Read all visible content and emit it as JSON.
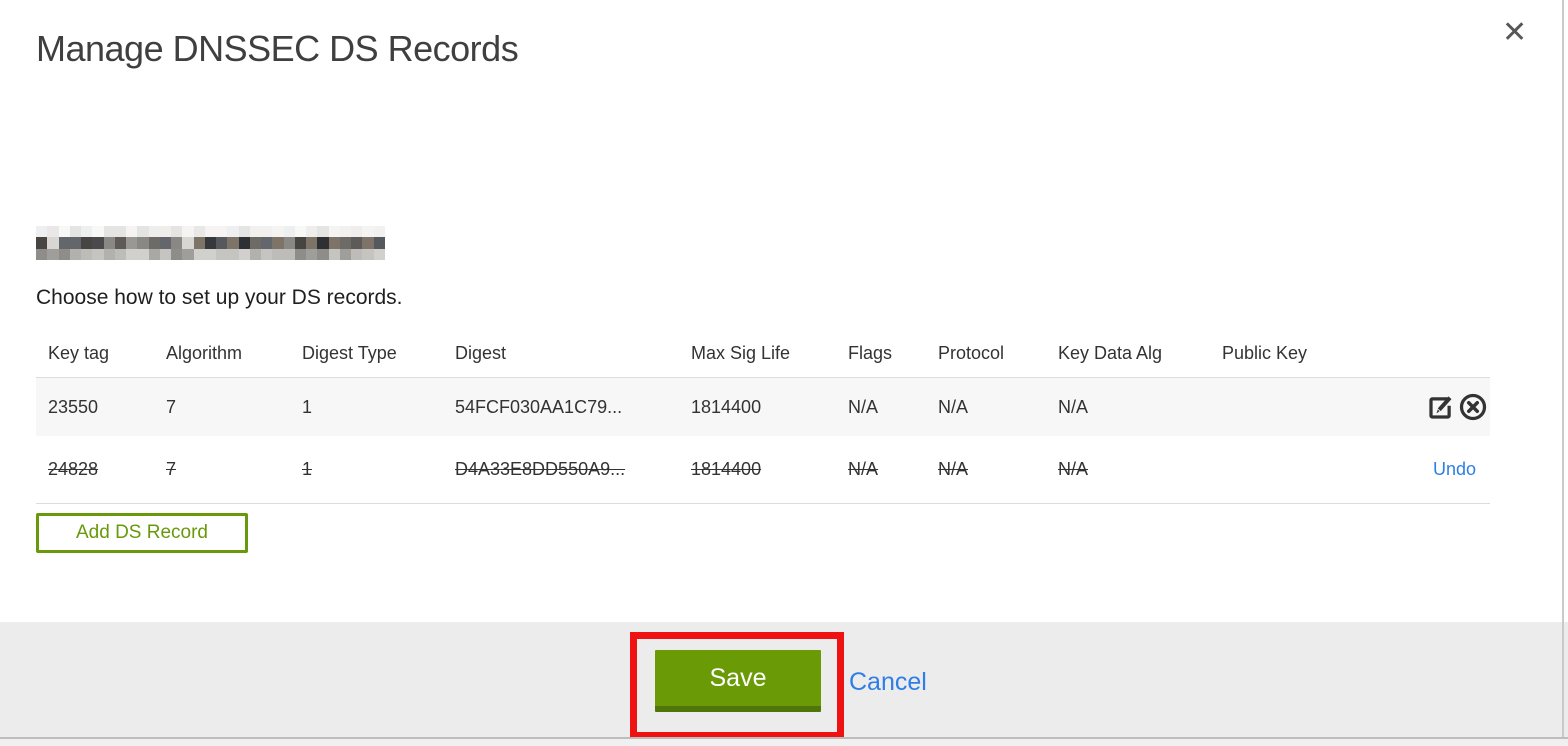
{
  "modal": {
    "title": "Manage DNSSEC DS Records",
    "close_icon": "close-icon",
    "close_glyph": "✕",
    "domain_redacted": true,
    "instruction": "Choose how to set up your DS records.",
    "table": {
      "columns": [
        "Key tag",
        "Algorithm",
        "Digest Type",
        "Digest",
        "Max Sig Life",
        "Flags",
        "Protocol",
        "Key Data Alg",
        "Public Key"
      ],
      "rows": [
        {
          "key_tag": "23550",
          "algorithm": "7",
          "digest_type": "1",
          "digest": "54FCF030AA1C79...",
          "max_sig_life": "1814400",
          "flags": "N/A",
          "protocol": "N/A",
          "key_data_alg": "N/A",
          "public_key": "",
          "state": "normal",
          "actions": [
            "edit-icon",
            "remove-circle-x-icon"
          ]
        },
        {
          "key_tag": "24828",
          "algorithm": "7",
          "digest_type": "1",
          "digest": "D4A33E8DD550A9...",
          "max_sig_life": "1814400",
          "flags": "N/A",
          "protocol": "N/A",
          "key_data_alg": "N/A",
          "public_key": "",
          "state": "marked-for-deletion",
          "action_label": "Undo"
        }
      ]
    },
    "add_button_label": "Add DS Record",
    "footer": {
      "save_label": "Save",
      "cancel_label": "Cancel",
      "annotation": "red-highlight-box"
    }
  },
  "colors": {
    "save_button_green": "#6a9b07",
    "save_button_green_dark": "#50750a",
    "add_button_green": "#68990a",
    "link_blue": "#2e7ee7",
    "annotation_red": "#ee1312",
    "footer_gray": "#ececec",
    "row_stripe_gray": "#f7f7f7"
  }
}
